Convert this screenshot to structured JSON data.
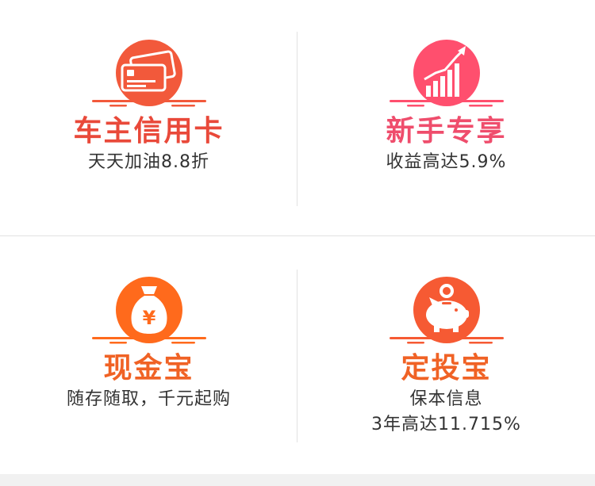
{
  "colors": {
    "card_orange": "#f2593b",
    "trend_pink": "#ff4f6e",
    "money_orange": "#ff6a1c",
    "piggy_orange": "#f65a33",
    "title_red": "#e9493a",
    "title_pink": "#ef4d6c",
    "title_orange": "#f06225",
    "subtitle_text": "#333333"
  },
  "cards": [
    {
      "icon": "credit-card-icon",
      "title": "车主信用卡",
      "subtitle": "天天加油8.8折"
    },
    {
      "icon": "growth-chart-icon",
      "title": "新手专享",
      "subtitle": "收益高达5.9%"
    },
    {
      "icon": "money-bag-icon",
      "title": "现金宝",
      "subtitle": "随存随取，千元起购"
    },
    {
      "icon": "piggy-bank-icon",
      "title": "定投宝",
      "subtitle_line1": "保本信息",
      "subtitle_line2": "3年高达11.715%"
    }
  ]
}
